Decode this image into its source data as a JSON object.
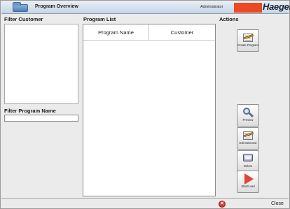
{
  "window": {
    "title": "Program Overview",
    "user": "Administrator",
    "brand": "Haeger"
  },
  "filter_customer": {
    "title": "Filter Customer"
  },
  "filter_program": {
    "title": "Filter Program Name",
    "value": ""
  },
  "program_list": {
    "title": "Program List",
    "columns": [
      "Program Name",
      "Customer"
    ],
    "rows": []
  },
  "actions": {
    "title": "Actions",
    "create": "Create Program",
    "preview": "Preview",
    "edit": "Edit Selected",
    "delete": "Delete",
    "start": "Start/Load"
  },
  "footer": {
    "close": "Close",
    "close_icon": "close-icon"
  },
  "colors": {
    "brand": "#f04a24",
    "close": "#d7352c"
  }
}
